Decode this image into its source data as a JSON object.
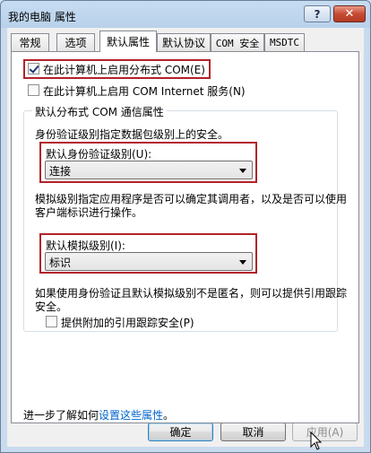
{
  "window": {
    "title": "我的电脑 属性",
    "help_label": "?",
    "close_label": "✕"
  },
  "tabs": [
    {
      "label": "常规",
      "active": false
    },
    {
      "label": "选项",
      "active": false
    },
    {
      "label": "默认属性",
      "active": true
    },
    {
      "label": "默认协议",
      "active": false
    },
    {
      "label": "COM 安全",
      "active": false
    },
    {
      "label": "MSDTC",
      "active": false
    }
  ],
  "options": {
    "enable_dcom": {
      "label": "在此计算机上启用分布式 COM(E)",
      "checked": true
    },
    "enable_com_internet": {
      "label": "在此计算机上启用 COM Internet 服务(N)",
      "checked": false
    }
  },
  "group": {
    "title": "默认分布式 COM 通信属性",
    "auth_desc": "身份验证级别指定数据包级别上的安全。",
    "auth_label": "默认身份验证级别(U):",
    "auth_value": "连接",
    "impersonation_desc": "模拟级别指定应用程序是否可以确定其调用者，以及是否可以使用客户端标识进行操作。",
    "impersonation_label": "默认模拟级别(I):",
    "impersonation_value": "标识",
    "tracking_desc": "如果使用身份验证且默认模拟级别不是匿名，则可以提供引用跟踪安全。",
    "tracking_option": {
      "label": "提供附加的引用跟踪安全(P)",
      "checked": false
    }
  },
  "footer": {
    "learn_prefix": "进一步了解如何",
    "learn_link": "设置这些属性",
    "learn_suffix": "。"
  },
  "buttons": {
    "ok": "确定",
    "cancel": "取消",
    "apply": "应用(A)"
  },
  "colors": {
    "highlight_box": "#b2222a",
    "link": "#0066cc"
  }
}
